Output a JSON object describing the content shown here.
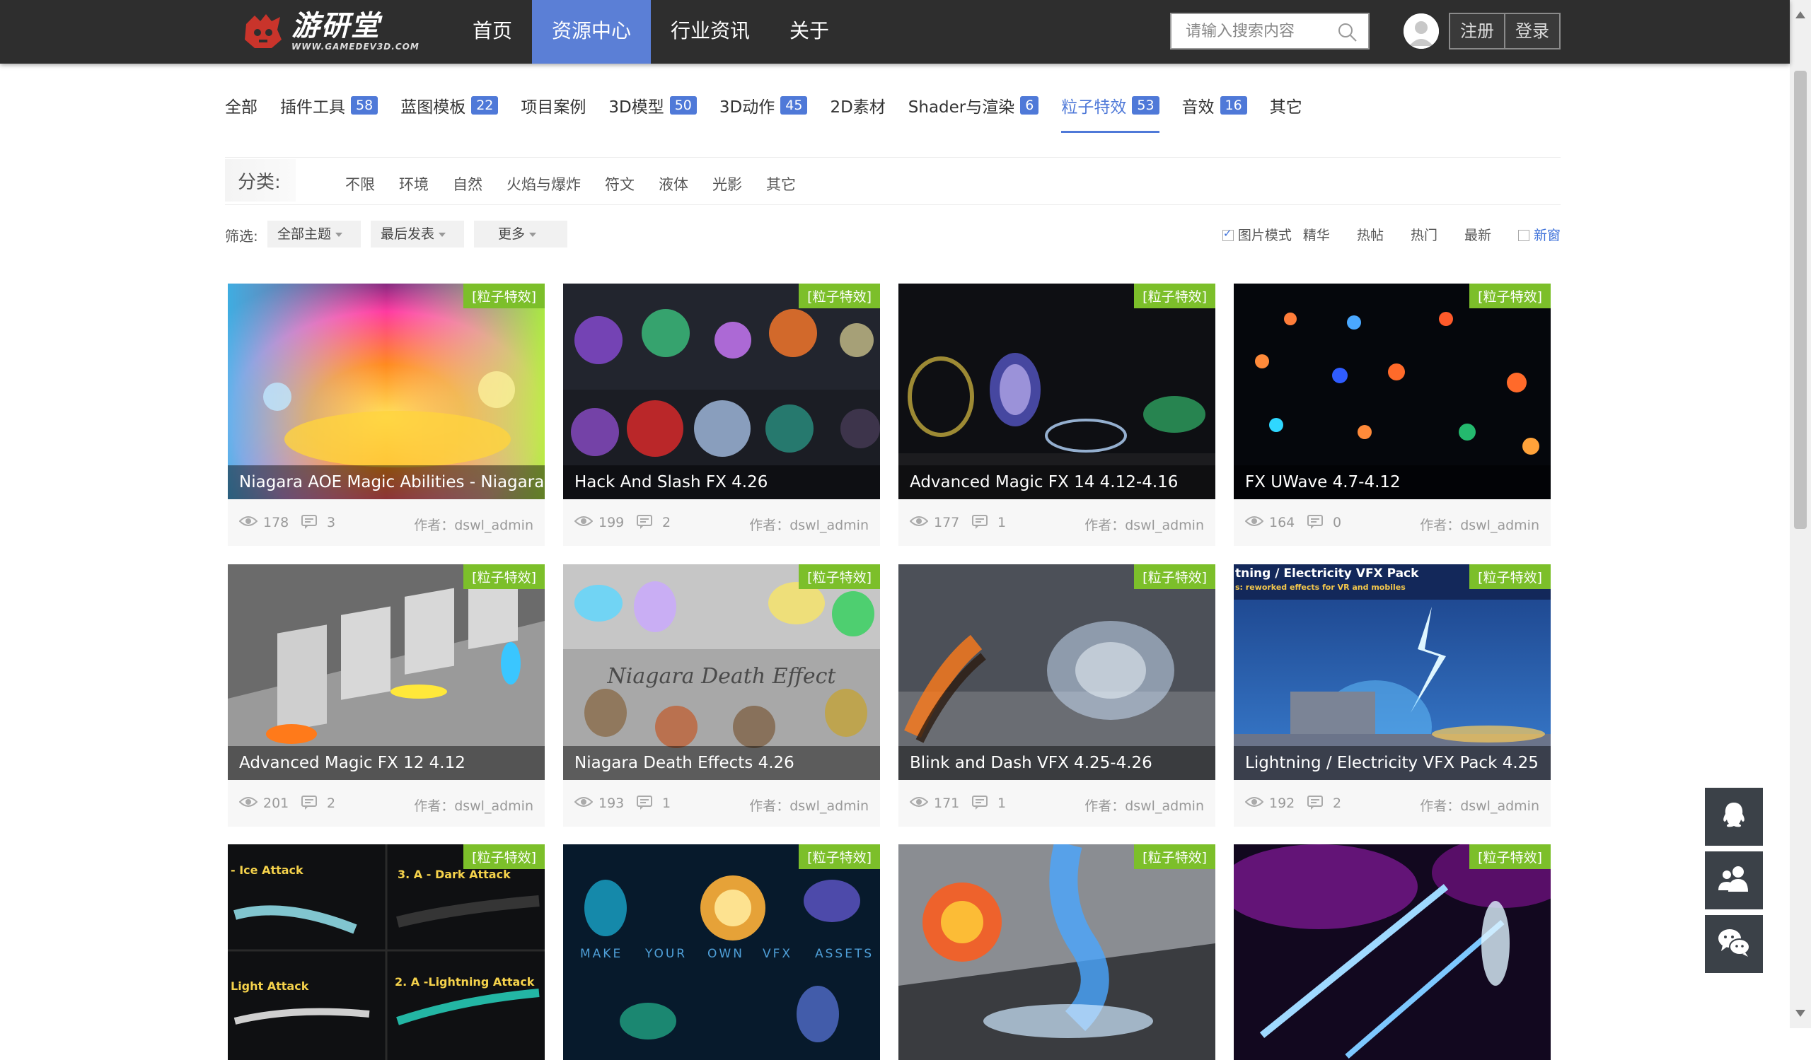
{
  "logo": {
    "title": "游研堂",
    "subtitle": "WWW.GAMEDEV3D.COM"
  },
  "nav": [
    {
      "label": "首页",
      "active": false
    },
    {
      "label": "资源中心",
      "active": true
    },
    {
      "label": "行业资讯",
      "active": false
    },
    {
      "label": "关于",
      "active": false
    }
  ],
  "search": {
    "placeholder": "请输入搜索内容"
  },
  "auth": {
    "register": "注册",
    "login": "登录"
  },
  "categories": [
    {
      "label": "全部",
      "count": ""
    },
    {
      "label": "插件工具",
      "count": "58"
    },
    {
      "label": "蓝图模板",
      "count": "22"
    },
    {
      "label": "项目案例",
      "count": ""
    },
    {
      "label": "3D模型",
      "count": "50"
    },
    {
      "label": "3D动作",
      "count": "45"
    },
    {
      "label": "2D素材",
      "count": ""
    },
    {
      "label": "Shader与渲染",
      "count": "6"
    },
    {
      "label": "粒子特效",
      "count": "53",
      "active": true
    },
    {
      "label": "音效",
      "count": "16"
    },
    {
      "label": "其它",
      "count": ""
    }
  ],
  "classification": {
    "label": "分类:",
    "items": [
      "不限",
      "环境",
      "自然",
      "火焰与爆炸",
      "符文",
      "液体",
      "光影",
      "其它"
    ]
  },
  "filters": {
    "label": "筛选:",
    "dropdowns": [
      "全部主题",
      "最后发表",
      "更多"
    ],
    "image_mode": "图片模式",
    "right": [
      "精华",
      "热帖",
      "热门",
      "最新"
    ],
    "new_window": "新窗"
  },
  "cards": [
    {
      "tag": "[粒子特效]",
      "title": "Niagara AOE Magic Abilities - Niagara",
      "views": "178",
      "comments": "3",
      "author": "作者：dswl_admin"
    },
    {
      "tag": "[粒子特效]",
      "title": "Hack And Slash FX 4.26",
      "views": "199",
      "comments": "2",
      "author": "作者：dswl_admin"
    },
    {
      "tag": "[粒子特效]",
      "title": "Advanced Magic FX 14 4.12-4.16",
      "views": "177",
      "comments": "1",
      "author": "作者：dswl_admin"
    },
    {
      "tag": "[粒子特效]",
      "title": "FX UWave 4.7-4.12",
      "views": "164",
      "comments": "0",
      "author": "作者：dswl_admin"
    },
    {
      "tag": "[粒子特效]",
      "title": "Advanced Magic FX 12 4.12",
      "views": "201",
      "comments": "2",
      "author": "作者：dswl_admin"
    },
    {
      "tag": "[粒子特效]",
      "title": "Niagara Death Effects 4.26",
      "views": "193",
      "comments": "1",
      "author": "作者：dswl_admin",
      "overlay": "Niagara Death Effect"
    },
    {
      "tag": "[粒子特效]",
      "title": "Blink and Dash VFX 4.25-4.26",
      "views": "171",
      "comments": "1",
      "author": "作者：dswl_admin"
    },
    {
      "tag": "[粒子特效]",
      "title": "Lightning / Electricity VFX Pack 4.25",
      "views": "192",
      "comments": "2",
      "author": "作者：dswl_admin",
      "overlay": "tning / Electricity VFX Pack",
      "overlay_sub": "s: reworked effects for VR and mobiles"
    },
    {
      "tag": "[粒子特效]",
      "overlay": [
        "- Ice Attack",
        "3. A - Dark Attack",
        "Light Attack",
        "2. A -Lightning Attack"
      ]
    },
    {
      "tag": "[粒子特效]",
      "overlay": [
        "MAKE",
        "YOUR",
        "OWN",
        "VFX",
        "ASSETS"
      ]
    },
    {
      "tag": "[粒子特效]"
    },
    {
      "tag": "[粒子特效]"
    }
  ],
  "colors": {
    "nav_active": "#5b7fd6",
    "accent": "#4f79d8",
    "tag": "#7cbf2a",
    "topbar": "#2e2e2e"
  },
  "side_buttons": [
    "qq-icon",
    "group-icon",
    "wechat-icon"
  ]
}
